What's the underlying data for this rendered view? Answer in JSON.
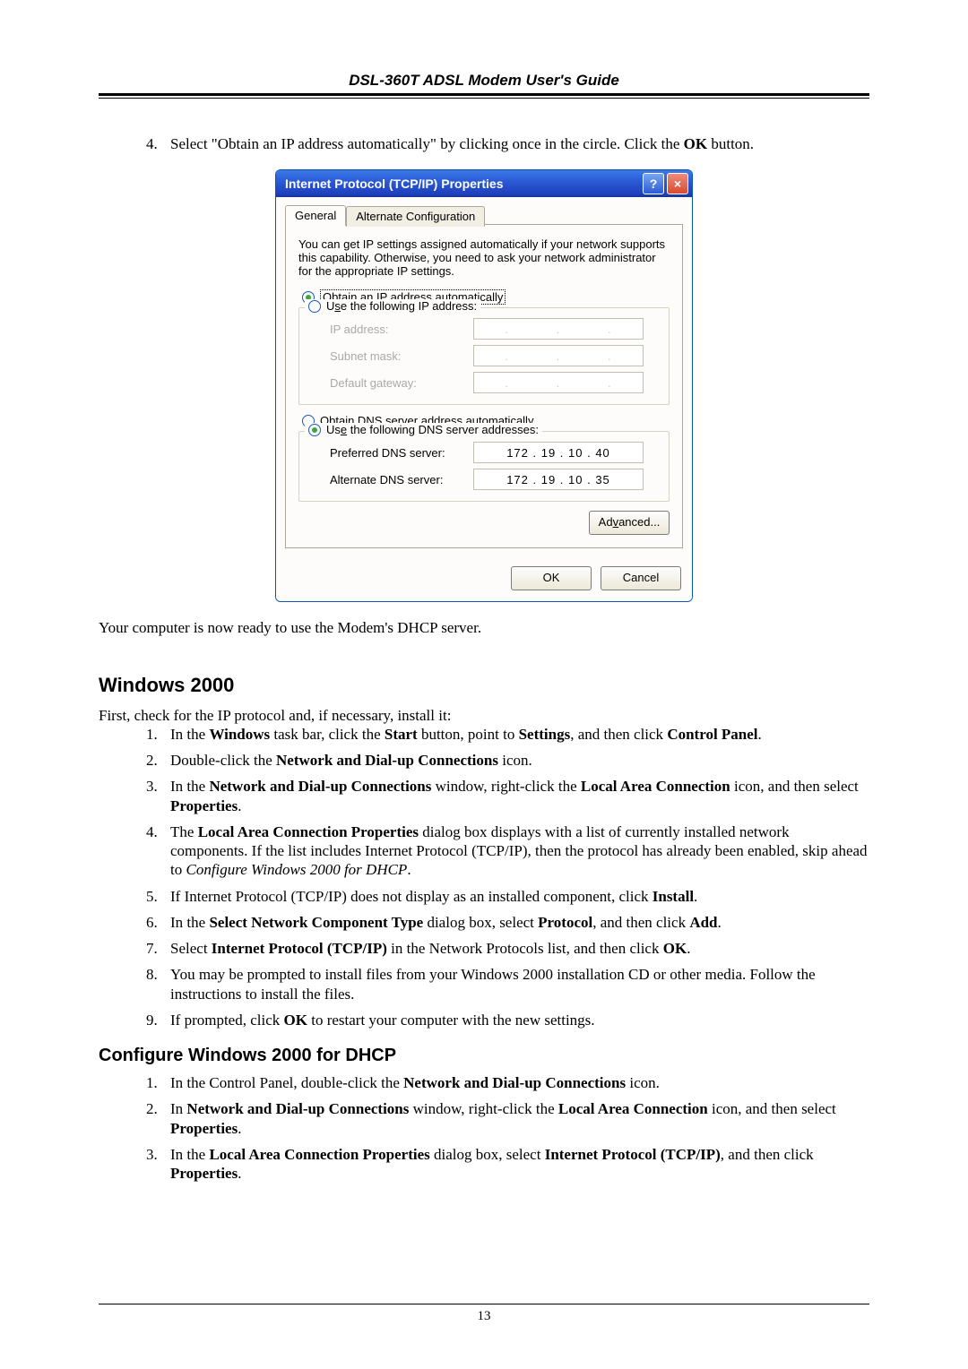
{
  "header": {
    "title": "DSL-360T ADSL Modem User's Guide"
  },
  "step4": {
    "num": "4.",
    "text_a": "Select \"Obtain an IP address automatically\" by clicking once in the circle. Click the ",
    "ok": "OK",
    "text_b": " button."
  },
  "dialog": {
    "title": "Internet Protocol (TCP/IP) Properties",
    "help_icon": "?",
    "close_icon": "×",
    "tabs": {
      "general": "General",
      "alt": "Alternate Configuration"
    },
    "desc": "You can get IP settings assigned automatically if your network supports this capability. Otherwise, you need to ask your network administrator for the appropriate IP settings.",
    "radios": {
      "obtain_ip": "Obtain an IP address automatically",
      "use_ip": "Use the following IP address:",
      "obtain_dns": "Obtain DNS server address automatically",
      "use_dns": "Use the following DNS server addresses:"
    },
    "labels": {
      "ip_address": "IP address:",
      "subnet": "Subnet mask:",
      "gateway": "Default gateway:",
      "pref_dns": "Preferred DNS server:",
      "alt_dns": "Alternate DNS server:"
    },
    "values": {
      "pref_dns": "172 . 19 . 10 . 40",
      "alt_dns": "172 . 19 . 10 . 35"
    },
    "advanced": "Advanced...",
    "ok": "OK",
    "cancel": "Cancel"
  },
  "after_dialog": "Your computer is now ready to use the Modem's DHCP server.",
  "win2000": {
    "heading": "Windows 2000",
    "intro": "First, check for the IP protocol and, if necessary, install it:",
    "items": {
      "1a": "In the ",
      "1_windows": "Windows",
      "1b": " task bar, click the ",
      "1_start": "Start",
      "1c": " button, point to ",
      "1_settings": "Settings",
      "1d": ", and then click ",
      "1_cp": "Control Panel",
      "1e": ".",
      "2a": "Double-click the ",
      "2_net": "Network and Dial-up Connections",
      "2b": " icon.",
      "3a": "In the ",
      "3_net": "Network and Dial-up Connections",
      "3b": " window, right-click the ",
      "3_lac": "Local Area Connection",
      "3c": " icon, and then select ",
      "3_props": "Properties",
      "3d": ".",
      "4a": "The ",
      "4_lacp": "Local Area Connection Properties",
      "4b": " dialog box displays with a list of currently installed network components. If the list includes Internet Protocol (TCP/IP), then the protocol has already been enabled, skip ahead to ",
      "4_cfg": "Configure Windows 2000 for DHCP",
      "4c": ".",
      "5a": "If Internet Protocol (TCP/IP) does not display as an installed component, click ",
      "5_install": "Install",
      "5b": ".",
      "6a": "In the ",
      "6_snct": "Select Network Component Type",
      "6b": " dialog box, select ",
      "6_proto": "Protocol",
      "6c": ", and then click ",
      "6_add": "Add",
      "6d": ".",
      "7a": "Select ",
      "7_iptcp": "Internet Protocol (TCP/IP)",
      "7b": " in the Network Protocols list, and then click ",
      "7_ok": "OK",
      "7c": ".",
      "8": "You may be prompted to install files from your Windows 2000 installation CD or other media. Follow the instructions to install the files.",
      "9a": "If prompted, click ",
      "9_ok": "OK",
      "9b": " to restart your computer with the new settings."
    }
  },
  "cfg2000": {
    "heading": "Configure Windows 2000 for DHCP",
    "items": {
      "1a": "In the Control Panel, double-click the ",
      "1_net": "Network and Dial-up Connections",
      "1b": " icon.",
      "2a": "In ",
      "2_net": "Network and Dial-up Connections",
      "2b": " window, right-click the ",
      "2_lac": "Local Area Connection",
      "2c": " icon, and then select ",
      "2_props": "Properties",
      "2d": ".",
      "3a": "In the ",
      "3_lacp": "Local Area Connection Properties",
      "3b": " dialog box, select ",
      "3_iptcp": "Internet Protocol (TCP/IP)",
      "3c": ", and then click ",
      "3_props": "Properties",
      "3d": "."
    }
  },
  "page_number": "13"
}
